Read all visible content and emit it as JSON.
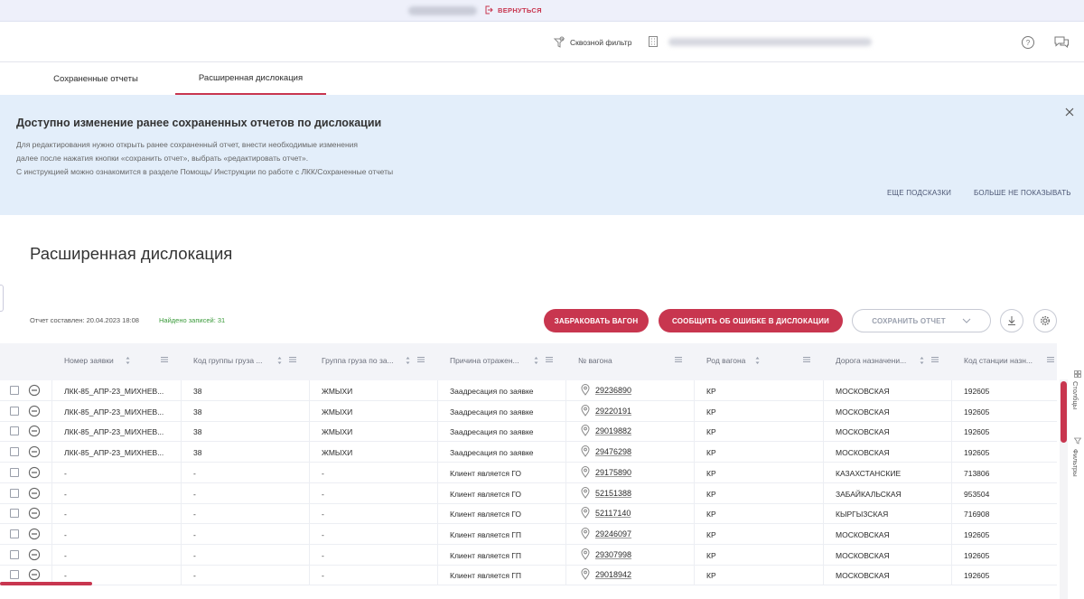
{
  "top_strip": {
    "return_label": "ВЕРНУТЬСЯ"
  },
  "header": {
    "through_filter": "Сквозной фильтр"
  },
  "tabs": [
    {
      "label": "Сохраненные отчеты",
      "active": false
    },
    {
      "label": "Расширенная дислокация",
      "active": true
    }
  ],
  "banner": {
    "title": "Доступно изменение ранее сохраненных отчетов по дислокации",
    "lines": [
      "Для редактирования нужно открыть ранее сохраненный отчет, внести необходимые изменения",
      "далее после нажатия кнопки «сохранить отчет», выбрать «редактировать отчет».",
      "С инструкцией можно ознакомится в разделе Помощь/ Инструкции по работе с ЛКК/Сохраненные отчеты"
    ],
    "more_hints": "ЕЩЕ ПОДСКАЗКИ",
    "dont_show": "БОЛЬШЕ НЕ ПОКАЗЫВАТЬ"
  },
  "page_title": "Расширенная дислокация",
  "report": {
    "date_label": "Отчет составлен: 20.04.2023 18:08",
    "found_label": "Найдено записей: 31"
  },
  "actions": {
    "reject": "ЗАБРАКОВАТЬ ВАГОН",
    "report_error": "СООБЩИТЬ ОБ ОШИБКЕ В ДИСЛОКАЦИИ",
    "save": "СОХРАНИТЬ ОТЧЕТ"
  },
  "columns": [
    "Номер заявки",
    "Код группы груза ...",
    "Группа груза по за...",
    "Причина отражен...",
    "№ вагона",
    "Род вагона",
    "Дорога назначени...",
    "Код станции назн..."
  ],
  "rows": [
    [
      "ЛКК-85_АПР-23_МИХНЕВ...",
      "38",
      "ЖМЫХИ",
      "Заадресация по заявке",
      "29236890",
      "КР",
      "МОСКОВСКАЯ",
      "192605"
    ],
    [
      "ЛКК-85_АПР-23_МИХНЕВ...",
      "38",
      "ЖМЫХИ",
      "Заадресация по заявке",
      "29220191",
      "КР",
      "МОСКОВСКАЯ",
      "192605"
    ],
    [
      "ЛКК-85_АПР-23_МИХНЕВ...",
      "38",
      "ЖМЫХИ",
      "Заадресация по заявке",
      "29019882",
      "КР",
      "МОСКОВСКАЯ",
      "192605"
    ],
    [
      "ЛКК-85_АПР-23_МИХНЕВ...",
      "38",
      "ЖМЫХИ",
      "Заадресация по заявке",
      "29476298",
      "КР",
      "МОСКОВСКАЯ",
      "192605"
    ],
    [
      "-",
      "-",
      "-",
      "Клиент является ГО",
      "29175890",
      "КР",
      "КАЗАХСТАНСКИЕ",
      "713806"
    ],
    [
      "-",
      "-",
      "-",
      "Клиент является ГО",
      "52151388",
      "КР",
      "ЗАБАЙКАЛЬСКАЯ",
      "953504"
    ],
    [
      "-",
      "-",
      "-",
      "Клиент является ГО",
      "52117140",
      "КР",
      "КЫРГЫЗСКАЯ",
      "716908"
    ],
    [
      "-",
      "-",
      "-",
      "Клиент является ГП",
      "29246097",
      "КР",
      "МОСКОВСКАЯ",
      "192605"
    ],
    [
      "-",
      "-",
      "-",
      "Клиент является ГП",
      "29307998",
      "КР",
      "МОСКОВСКАЯ",
      "192605"
    ],
    [
      "-",
      "-",
      "-",
      "Клиент является ГП",
      "29018942",
      "КР",
      "МОСКОВСКАЯ",
      "192605"
    ]
  ],
  "side": {
    "columns_label": "Столбцы",
    "filters_label": "Фильтры"
  },
  "colors": {
    "accent": "#c8364f",
    "banner_bg": "#e3eefa",
    "found_green": "#3a9a3a"
  }
}
